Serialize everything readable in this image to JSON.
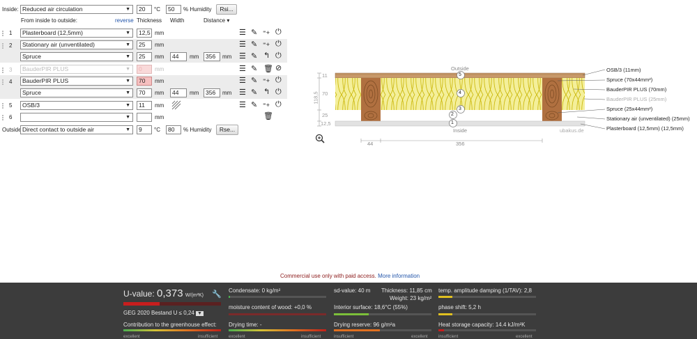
{
  "inside": {
    "label": "Inside:",
    "condition": "Reduced air circulation",
    "temp": "20",
    "temp_unit": "°C",
    "humidity": "50",
    "humidity_unit": "% Humidity",
    "rsi_button": "Rsi..."
  },
  "header": {
    "from_inside": "From inside to outside:",
    "reverse": "reverse",
    "thickness": "Thickness",
    "width": "Width",
    "distance": "Distance",
    "distance_arrow": "▾"
  },
  "layers": [
    {
      "num": "1",
      "material": "Plasterboard (12,5mm)",
      "thickness": "12,5",
      "unit": "mm"
    },
    {
      "num": "2",
      "material": "Stationary air (unventilated)",
      "thickness": "25",
      "unit": "mm"
    },
    {
      "num": "",
      "material": "Spruce",
      "thickness": "25",
      "unit": "mm",
      "width": "44",
      "width_unit": "mm",
      "distance": "356",
      "distance_unit": "mm"
    },
    {
      "num": "3",
      "material": "BauderPIR PLUS",
      "thickness": "0",
      "unit": "mm"
    },
    {
      "num": "4",
      "material": "BauderPIR PLUS",
      "thickness": "70",
      "unit": "mm"
    },
    {
      "num": "",
      "material": "Spruce",
      "thickness": "70",
      "unit": "mm",
      "width": "44",
      "width_unit": "mm",
      "distance": "356",
      "distance_unit": "mm"
    },
    {
      "num": "5",
      "material": "OSB/3",
      "thickness": "11",
      "unit": "mm"
    },
    {
      "num": "6",
      "material": "",
      "thickness": "",
      "unit": "mm"
    }
  ],
  "outside": {
    "label": "Outside",
    "condition": "Direct contact to outside air",
    "temp": "9",
    "temp_unit": "°C",
    "humidity": "80",
    "humidity_unit": "% Humidity",
    "rse_button": "Rse..."
  },
  "diagram": {
    "outside_label": "Outside",
    "inside_label": "Inside",
    "watermark": "ubakus.de",
    "dims_left": [
      "11",
      "118,5",
      "70",
      "25",
      "12,5"
    ],
    "dims_bottom": [
      "44",
      "356"
    ],
    "markers": [
      "5",
      "4",
      "3",
      "2",
      "1"
    ],
    "legend": [
      "OSB/3 (11mm)",
      "Spruce (70x44mm²)",
      "BauderPIR PLUS (70mm)",
      "BauderPIR PLUS (25mm)",
      "Spruce (25x44mm²)",
      "Stationary air (unventilated) (25mm)",
      "Plasterboard (12,5mm) (12,5mm)"
    ],
    "colors": {
      "osb": "#c8996a",
      "insulation": "#f4ef9a",
      "insulation_line": "#c8b400",
      "wood": "#b07040",
      "air": "#e6e6e6",
      "plaster": "#dcdcdc"
    }
  },
  "notice": {
    "text": "Commercial use only with paid access.",
    "link": "More information"
  },
  "results": {
    "uvalue_label": "U-value:",
    "uvalue": "0,373",
    "uvalue_unit": "W/(m²K)",
    "geg": "GEG 2020 Bestand U ≤ 0,24",
    "greenhouse": "Contribution to the greenhouse effect:",
    "condensate": "Condensate: 0 kg/m²",
    "moisture": "moisture content of wood: +0,0 %",
    "drying_time": "Drying time: -",
    "sd_value": "sd-value: 40 m",
    "thickness": "Thickness: 11,85 cm",
    "weight": "Weight: 23 kg/m²",
    "interior_surface": "Interior surface: 18,6°C (55%)",
    "drying_reserve": "Drying reserve: 96 g/m²a",
    "temp_amplitude": "temp. amplitude damping (1/TAV): 2,8",
    "phase_shift": "phase shift: 5,2 h",
    "heat_storage": "Heat storage capacity: 14.4 kJ/m²K",
    "scale_good": "excellent",
    "scale_bad": "insufficient",
    "levels": {
      "uvalue": 0.3,
      "condensate": 0.0,
      "moisture": 0.0,
      "interior": 0.35,
      "drying_reserve": 0.85,
      "amplitude": 0.15,
      "phase": 0.15,
      "heat": 0.05
    }
  }
}
